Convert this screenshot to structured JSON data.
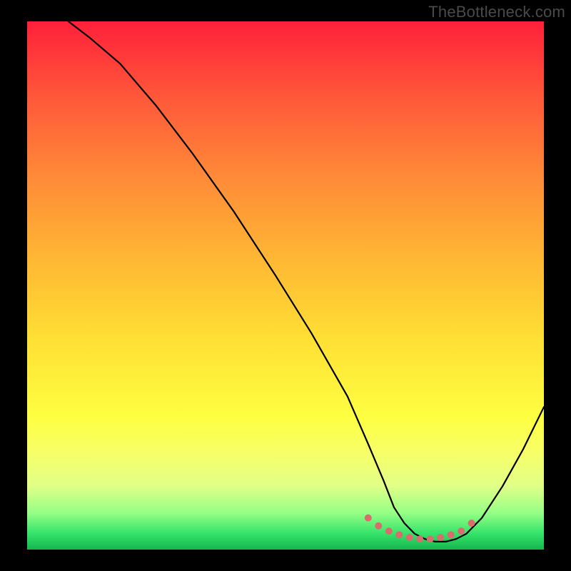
{
  "watermark": "TheBottleneck.com",
  "chart_data": {
    "type": "line",
    "title": "",
    "xlabel": "",
    "ylabel": "",
    "xlim": [
      0,
      100
    ],
    "ylim": [
      0,
      100
    ],
    "grid": false,
    "legend": false,
    "series": [
      {
        "name": "curve",
        "x": [
          8,
          12,
          18,
          25,
          32,
          40,
          48,
          55,
          62,
          66,
          69,
          71,
          73,
          75,
          77,
          79,
          81,
          83,
          85,
          88,
          92,
          96,
          100
        ],
        "y": [
          100,
          97,
          92,
          84,
          75,
          64,
          52,
          41,
          29,
          20,
          13,
          8,
          5,
          3,
          2,
          1.5,
          1.5,
          2,
          3,
          6,
          12,
          19,
          27
        ]
      }
    ],
    "markers": {
      "color": "#d86d6d",
      "size": 5,
      "points_x": [
        66,
        68,
        70,
        72,
        74,
        76,
        78,
        80,
        82,
        84,
        86
      ],
      "points_y": [
        6,
        4.5,
        3.5,
        2.8,
        2.3,
        2,
        2,
        2.3,
        2.8,
        3.5,
        5
      ]
    }
  }
}
